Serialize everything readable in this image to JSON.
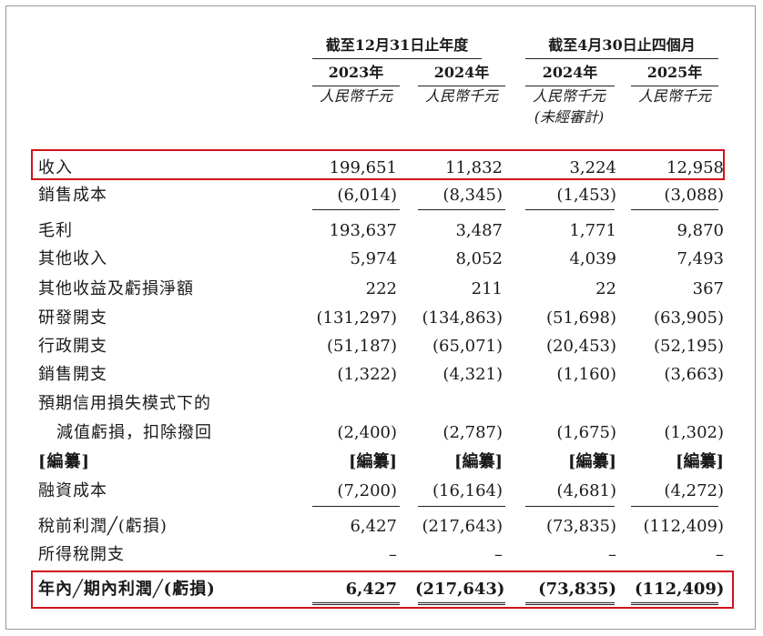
{
  "header": {
    "group1": "截至12月31日止年度",
    "group2": "截至4月30日止四個月",
    "years": [
      "2023年",
      "2024年",
      "2024年",
      "2025年"
    ],
    "units": [
      "人民幣千元",
      "人民幣千元",
      "人民幣千元",
      "人民幣千元"
    ],
    "unaudited": "(未經審計)"
  },
  "rows": [
    {
      "label": "收入",
      "values": [
        "199,651",
        "11,832",
        "3,224",
        "12,958"
      ]
    },
    {
      "label": "銷售成本",
      "values": [
        "(6,014)",
        "(8,345)",
        "(1,453)",
        "(3,088)"
      ]
    },
    {
      "label": "毛利",
      "values": [
        "193,637",
        "3,487",
        "1,771",
        "9,870"
      ]
    },
    {
      "label": "其他收入",
      "values": [
        "5,974",
        "8,052",
        "4,039",
        "7,493"
      ]
    },
    {
      "label": "其他收益及虧損淨額",
      "values": [
        "222",
        "211",
        "22",
        "367"
      ]
    },
    {
      "label": "研發開支",
      "values": [
        "(131,297)",
        "(134,863)",
        "(51,698)",
        "(63,905)"
      ]
    },
    {
      "label": "行政開支",
      "values": [
        "(51,187)",
        "(65,071)",
        "(20,453)",
        "(52,195)"
      ]
    },
    {
      "label": "銷售開支",
      "values": [
        "(1,322)",
        "(4,321)",
        "(1,160)",
        "(3,663)"
      ]
    },
    {
      "label": "預期信用損失模式下的",
      "values": [
        "",
        "",
        "",
        ""
      ]
    },
    {
      "label": "減值虧損，扣除撥回",
      "values": [
        "(2,400)",
        "(2,787)",
        "(1,675)",
        "(1,302)"
      ]
    },
    {
      "label": "[編纂]",
      "values": [
        "[編纂]",
        "[編纂]",
        "[編纂]",
        "[編纂]"
      ]
    },
    {
      "label": "融資成本",
      "values": [
        "(7,200)",
        "(16,164)",
        "(4,681)",
        "(4,272)"
      ]
    },
    {
      "label": "稅前利潤╱(虧損)",
      "values": [
        "6,427",
        "(217,643)",
        "(73,835)",
        "(112,409)"
      ]
    },
    {
      "label": "所得稅開支",
      "values": [
        "–",
        "–",
        "–",
        "–"
      ]
    },
    {
      "label": "年內╱期內利潤╱(虧損)",
      "values": [
        "6,427",
        "(217,643)",
        "(73,835)",
        "(112,409)"
      ]
    }
  ],
  "highlight_color": "#d0121b"
}
